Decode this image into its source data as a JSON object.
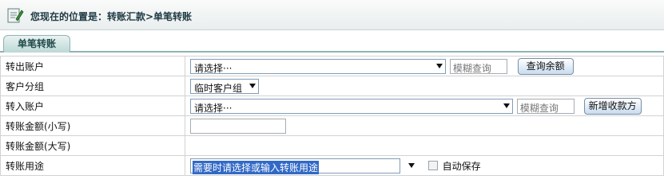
{
  "header": {
    "icon": "edit-document-icon",
    "breadcrumb": "您现在的位置是：转账汇款>单笔转账"
  },
  "tabs": [
    {
      "label": "单笔转账",
      "active": true
    }
  ],
  "form": {
    "out_account": {
      "label": "转出账户",
      "select_value": "请选择···",
      "search_placeholder": "模糊查询",
      "button": "查询余额"
    },
    "customer_group": {
      "label": "客户分组",
      "select_value": "临时客户组"
    },
    "in_account": {
      "label": "转入账户",
      "select_value": "请选择···",
      "search_placeholder": "模糊查询",
      "button": "新增收款方"
    },
    "amount_lower": {
      "label": "转账金额(小写)",
      "value": ""
    },
    "amount_upper": {
      "label": "转账金额(大写)",
      "value": ""
    },
    "purpose": {
      "label": "转账用途",
      "value": "需要时请选择或输入转账用途",
      "autosave_label": "自动保存",
      "autosave_checked": false
    }
  },
  "colors": {
    "accent": "#8fb3b3",
    "selection": "#3169c6",
    "header_text": "#1f3a44"
  }
}
